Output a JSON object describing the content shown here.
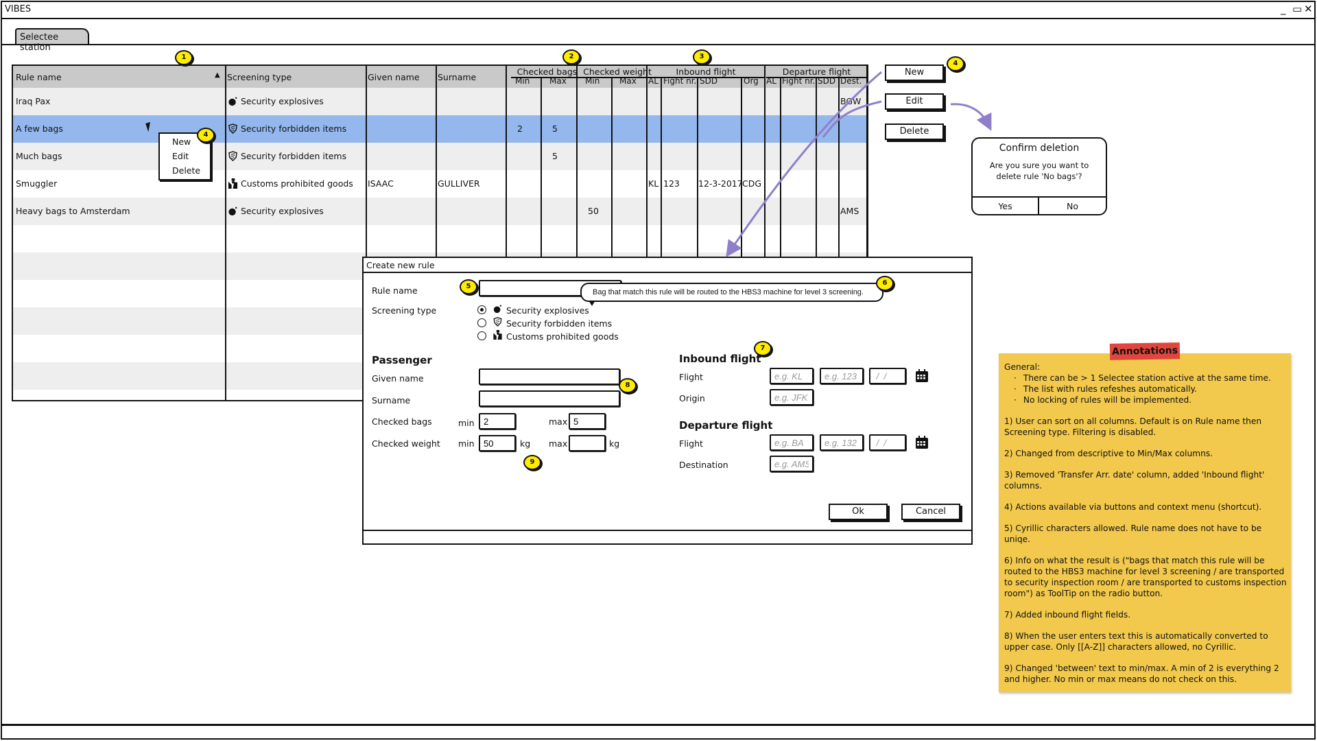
{
  "window": {
    "title": "VIBES",
    "controls": {
      "minimize": "_",
      "maximize": "▭",
      "close": "✕"
    }
  },
  "tabs": [
    {
      "label": "Selectee station",
      "active": true
    }
  ],
  "table": {
    "headers": {
      "rule_name": "Rule name",
      "screening_type": "Screening type",
      "given_name": "Given name",
      "surname": "Surname",
      "checked_bags": "Checked bags",
      "checked_weight": "Checked weight",
      "inbound_flight": "Inbound flight",
      "departure_flight": "Departure flight",
      "min": "Min",
      "max": "Max",
      "al": "AL",
      "flight_nr": "Fight nr.",
      "sdd": "SDD",
      "org": "Org",
      "dest": "Dest."
    },
    "sort": {
      "column": "Rule name",
      "direction": "ascending"
    },
    "rows": [
      {
        "rule_name": "Iraq Pax",
        "screening_type": "Security explosives",
        "icon": "bomb-icon",
        "given_name": "",
        "surname": "",
        "bags_min": "",
        "bags_max": "",
        "weight_min": "",
        "weight_max": "",
        "in_al": "",
        "in_flight": "",
        "in_sdd": "",
        "in_org": "",
        "dep_al": "",
        "dep_flight": "",
        "dep_sdd": "",
        "dep_dest": "BGW",
        "selected": false
      },
      {
        "rule_name": "A few bags",
        "screening_type": "Security forbidden items",
        "icon": "shield-icon",
        "given_name": "",
        "surname": "",
        "bags_min": "2",
        "bags_max": "5",
        "weight_min": "",
        "weight_max": "",
        "in_al": "",
        "in_flight": "",
        "in_sdd": "",
        "in_org": "",
        "dep_al": "",
        "dep_flight": "",
        "dep_sdd": "",
        "dep_dest": "",
        "selected": true
      },
      {
        "rule_name": "Much bags",
        "screening_type": "Security forbidden items",
        "icon": "shield-icon",
        "given_name": "",
        "surname": "",
        "bags_min": "",
        "bags_max": "5",
        "weight_min": "",
        "weight_max": "",
        "in_al": "",
        "in_flight": "",
        "in_sdd": "",
        "in_org": "",
        "dep_al": "",
        "dep_flight": "",
        "dep_sdd": "",
        "dep_dest": "",
        "selected": false
      },
      {
        "rule_name": "Smuggler",
        "screening_type": "Customs prohibited goods",
        "icon": "customs-officer-icon",
        "given_name": "ISAAC",
        "surname": "GULLIVER",
        "bags_min": "",
        "bags_max": "",
        "weight_min": "",
        "weight_max": "",
        "in_al": "KL",
        "in_flight": "123",
        "in_sdd": "12-3-2017",
        "in_org": "CDG",
        "dep_al": "",
        "dep_flight": "",
        "dep_sdd": "",
        "dep_dest": "",
        "selected": false
      },
      {
        "rule_name": "Heavy bags to Amsterdam",
        "screening_type": "Security explosives",
        "icon": "bomb-icon",
        "given_name": "",
        "surname": "",
        "bags_min": "",
        "bags_max": "",
        "weight_min": "50",
        "weight_max": "",
        "in_al": "",
        "in_flight": "",
        "in_sdd": "",
        "in_org": "",
        "dep_al": "",
        "dep_flight": "",
        "dep_sdd": "",
        "dep_dest": "AMS",
        "selected": false
      }
    ]
  },
  "context_menu": {
    "items": [
      "New",
      "Edit",
      "Delete"
    ]
  },
  "actions": {
    "new": "New",
    "edit": "Edit",
    "delete": "Delete"
  },
  "confirm_dialog": {
    "title": "Confirm deletion",
    "message_line1": "Are you sure you want to",
    "message_line2": "delete rule 'No bags'?",
    "yes": "Yes",
    "no": "No"
  },
  "create_dialog": {
    "title": "Create new rule",
    "rule_name_label": "Rule name",
    "rule_name_value": "",
    "screening_type_label": "Screening type",
    "screening_options": [
      {
        "label": "Security explosives",
        "icon": "bomb-icon",
        "selected": true
      },
      {
        "label": "Security forbidden items",
        "icon": "shield-icon",
        "selected": false
      },
      {
        "label": "Customs prohibited goods",
        "icon": "customs-officer-icon",
        "selected": false
      }
    ],
    "tooltip": "Bag that match this rule will be routed to the HBS3 machine for level 3 screening.",
    "passenger": {
      "heading": "Passenger",
      "given_name_label": "Given name",
      "given_name_value": "",
      "surname_label": "Surname",
      "surname_value": "",
      "checked_bags_label": "Checked bags",
      "checked_weight_label": "Checked weight",
      "min_label": "min",
      "max_label": "max",
      "kg_label": "kg",
      "bags_min": "2",
      "bags_max": "5",
      "weight_min": "50",
      "weight_max": ""
    },
    "inbound": {
      "heading": "Inbound flight",
      "flight_label": "Flight",
      "origin_label": "Origin",
      "airline_placeholder": "e.g. KL",
      "number_placeholder": "e.g. 123",
      "date_placeholder": " /  /",
      "origin_placeholder": "e.g. JFK"
    },
    "departure": {
      "heading": "Departure flight",
      "flight_label": "Flight",
      "destination_label": "Destination",
      "airline_placeholder": "e.g. BA",
      "number_placeholder": "e.g. 132",
      "date_placeholder": " /  /",
      "destination_placeholder": "e.g. AMS"
    },
    "ok": "Ok",
    "cancel": "Cancel"
  },
  "callouts": [
    "1",
    "2",
    "3",
    "4",
    "4",
    "5",
    "6",
    "7",
    "8",
    "9"
  ],
  "annotations": {
    "title": "Annotations",
    "general_heading": "General:",
    "general_items": [
      "There can be > 1 Selectee station active at the same time.",
      "The list with rules refeshes automatically.",
      "No locking of rules will be implemented."
    ],
    "notes": [
      "1) User can sort on all columns. Default is on Rule name then Screening type. Filtering is disabled.",
      "2) Changed from descriptive to Min/Max columns.",
      "3) Removed 'Transfer Arr. date' column, added 'Inbound flight' columns.",
      "4) Actions available via buttons and context menu (shortcut).",
      "5) Cyrillic characters allowed. Rule name does not have to be uniqe.",
      "6) Info on what the result is (\"bags that match this rule will be routed to the HBS3 machine for level 3 screening / are transported to security inspection room / are transported to customs inspection room\") as ToolTip on the radio button.",
      "7) Added inbound flight fields.",
      "8) When the user enters text this is automatically converted to upper case. Only [[A-Z]] characters allowed, no Cyrillic.",
      "9) Changed 'between' text to min/max. A min of 2 is everything 2 and higher. No min or max means do not check on this."
    ]
  },
  "colors": {
    "selected_row": "#94b8ee",
    "header_bg": "#c9c9c9",
    "alt_row": "#eeeeee",
    "callout": "#ffec00",
    "note_bg": "#f2c94c",
    "note_tag": "#e0463d",
    "arrow": "#8f7fc9"
  }
}
